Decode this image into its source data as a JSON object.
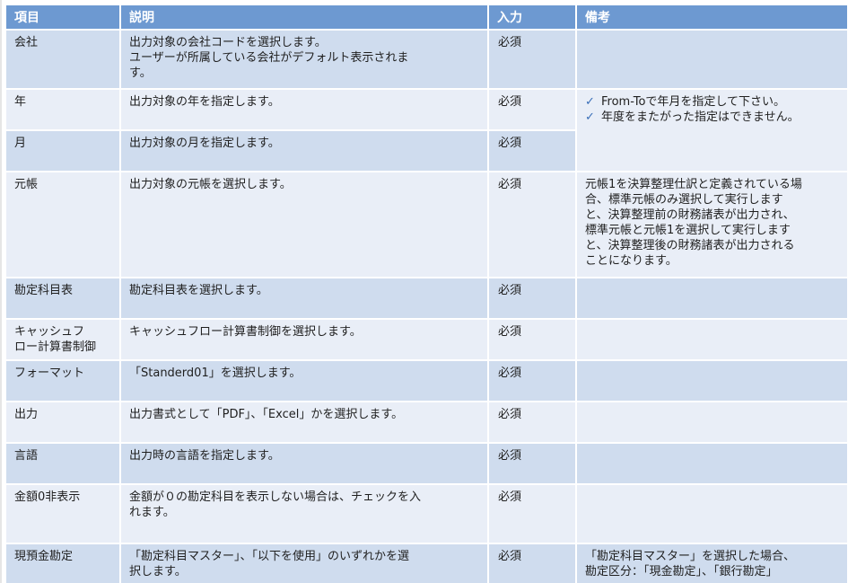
{
  "table": {
    "headers": [
      "項目",
      "説明",
      "入力",
      "備考"
    ],
    "rows": [
      {
        "item": "会社",
        "desc": [
          "出力対象の会社コードを選択します。",
          "ユーザーが所属している会社がデフォルト表示されま",
          "す。"
        ],
        "input": "必須"
      },
      {
        "item": "年",
        "desc": [
          "出力対象の年を指定します。"
        ],
        "input": "必須"
      },
      {
        "item": "月",
        "desc": [
          "出力対象の月を指定します。"
        ],
        "input": "必須"
      },
      {
        "item": "元帳",
        "desc": [
          "出力対象の元帳を選択します。"
        ],
        "input": "必須"
      },
      {
        "item": "勘定科目表",
        "desc": [
          "勘定科目表を選択します。"
        ],
        "input": "必須"
      },
      {
        "item_lines": [
          "キャッシュフ",
          "ロー計算書制御"
        ],
        "desc": [
          "キャッシュフロー計算書制御を選択します。"
        ],
        "input": "必須"
      },
      {
        "item": "フォーマット",
        "desc": [
          "「Standerd01」を選択します。"
        ],
        "input": "必須"
      },
      {
        "item": "出力",
        "desc": [
          "出力書式として「PDF」、「Excel」かを選択します。"
        ],
        "input": "必須"
      },
      {
        "item": "言語",
        "desc": [
          "出力時の言語を指定します。"
        ],
        "input": "必須"
      },
      {
        "item": "金額0非表示",
        "desc": [
          "金額が０の勘定科目を表示しない場合は、チェックを入",
          "れます。"
        ],
        "input": "必須"
      },
      {
        "item": "現預金勘定",
        "desc": [
          "「勘定科目マスター」、「以下を使用」のいずれかを選",
          "択します。"
        ],
        "input": "必須"
      }
    ],
    "notes": {
      "year_month": [
        "From-Toで年月を指定して下さい。",
        "年度をまたがった指定はできません。"
      ],
      "ledger": [
        "元帳1を決算整理仕訳と定義されている場",
        "合、標準元帳のみ選択して実行します",
        "と、決算整理前の財務諸表が出力され、",
        "標準元帳と元帳1を選択して実行します",
        "と、決算整理後の財務諸表が出力される",
        "ことになります。"
      ],
      "cash": [
        "「勘定科目マスター」を選択した場合、",
        "勘定区分：「現金勘定」、「銀行勘定」"
      ]
    },
    "check_icon": "check-icon",
    "colors": {
      "header": "#6d99d1",
      "row_dark": "#cfdcee",
      "row_light": "#e9eef7"
    }
  }
}
